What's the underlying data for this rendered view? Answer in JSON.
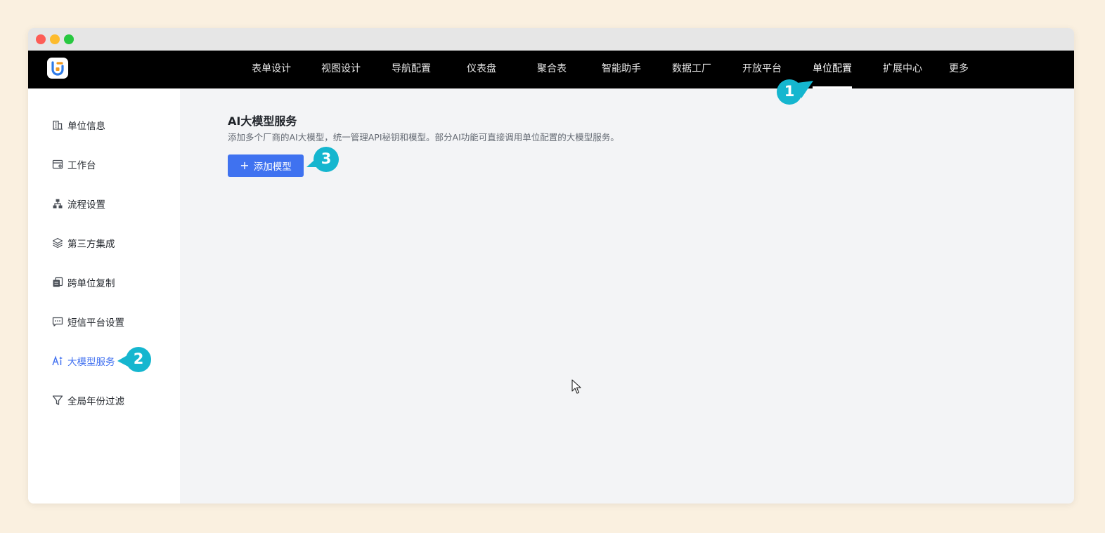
{
  "app": {
    "logo_icon": "app-logo-icon"
  },
  "topnav": {
    "items": [
      {
        "label": "表单设计"
      },
      {
        "label": "视图设计"
      },
      {
        "label": "导航配置"
      },
      {
        "label": "仪表盘"
      },
      {
        "label": "聚合表"
      },
      {
        "label": "智能助手"
      },
      {
        "label": "数据工厂"
      },
      {
        "label": "开放平台"
      },
      {
        "label": "单位配置",
        "active": true
      },
      {
        "label": "扩展中心"
      },
      {
        "label": "更多"
      }
    ]
  },
  "sidebar": {
    "items": [
      {
        "label": "单位信息",
        "icon": "building-icon"
      },
      {
        "label": "工作台",
        "icon": "workbench-icon"
      },
      {
        "label": "流程设置",
        "icon": "flow-icon"
      },
      {
        "label": "第三方集成",
        "icon": "layers-icon"
      },
      {
        "label": "跨单位复制",
        "icon": "copy-icon"
      },
      {
        "label": "短信平台设置",
        "icon": "message-icon"
      },
      {
        "label": "大模型服务",
        "icon": "ai-icon",
        "active": true
      },
      {
        "label": "全局年份过滤",
        "icon": "filter-icon"
      }
    ]
  },
  "main": {
    "title": "AI大模型服务",
    "description": "添加多个厂商的AI大模型，统一管理API秘钥和模型。部分AI功能可直接调用单位配置的大模型服务。",
    "add_button_label": "添加模型"
  },
  "callouts": {
    "one": "1",
    "two": "2",
    "three": "3"
  },
  "colors": {
    "accent": "#3f72f0",
    "callout": "#15b6cf",
    "nav_bg": "#000000",
    "page_bg": "#faf0e0"
  }
}
